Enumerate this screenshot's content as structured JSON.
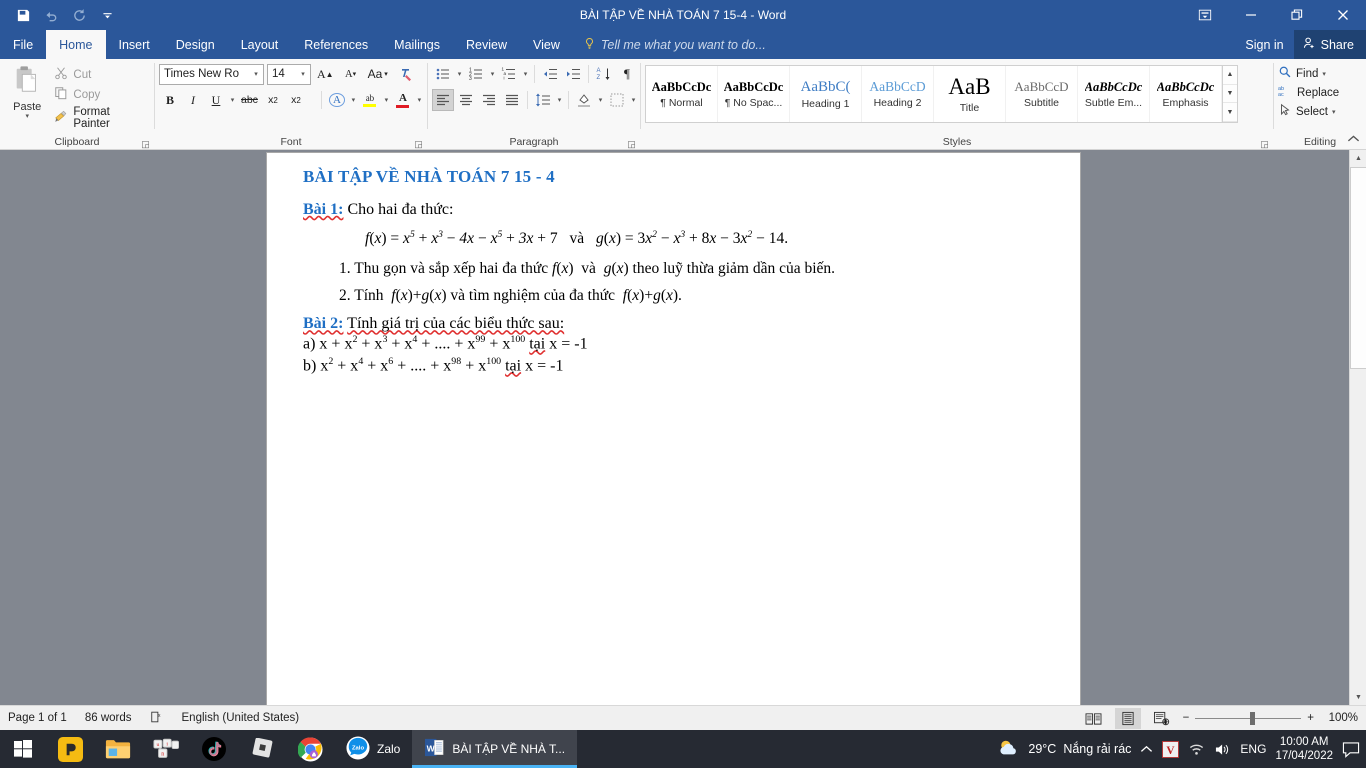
{
  "titlebar": {
    "title": "BÀI TẬP VỀ NHÀ TOÁN 7 15-4 - Word",
    "qat": [
      {
        "name": "save-icon",
        "label": "Save"
      },
      {
        "name": "undo-icon",
        "label": "Undo"
      },
      {
        "name": "redo-icon",
        "label": "Redo"
      },
      {
        "name": "customize-qat-icon",
        "label": "Customize Quick Access Toolbar"
      }
    ],
    "window_controls": [
      {
        "name": "ribbon-display-options-button",
        "label": "Ribbon Display Options"
      },
      {
        "name": "minimize-button",
        "label": "Minimize"
      },
      {
        "name": "restore-button",
        "label": "Restore Down"
      },
      {
        "name": "close-button",
        "label": "Close"
      }
    ]
  },
  "tabs": [
    {
      "label": "File",
      "active": false
    },
    {
      "label": "Home",
      "active": true
    },
    {
      "label": "Insert",
      "active": false
    },
    {
      "label": "Design",
      "active": false
    },
    {
      "label": "Layout",
      "active": false
    },
    {
      "label": "References",
      "active": false
    },
    {
      "label": "Mailings",
      "active": false
    },
    {
      "label": "Review",
      "active": false
    },
    {
      "label": "View",
      "active": false
    }
  ],
  "tell_me": "Tell me what you want to do...",
  "account": {
    "sign_in": "Sign in",
    "share": "Share"
  },
  "ribbon": {
    "clipboard": {
      "group_label": "Clipboard",
      "paste_label": "Paste",
      "cut_label": "Cut",
      "copy_label": "Copy",
      "format_painter_label": "Format Painter"
    },
    "font": {
      "group_label": "Font",
      "font_name": "Times New Ro",
      "font_size": "14",
      "buttons": [
        {
          "name": "grow-font-button",
          "label": "A"
        },
        {
          "name": "shrink-font-button",
          "label": "A"
        },
        {
          "name": "change-case-button",
          "label": "Aa"
        },
        {
          "name": "clear-formatting-button",
          "label": "Clear Formatting"
        },
        {
          "name": "bold-button",
          "label": "B"
        },
        {
          "name": "italic-button",
          "label": "I"
        },
        {
          "name": "underline-button",
          "label": "U"
        },
        {
          "name": "strikethrough-button",
          "label": "abc"
        },
        {
          "name": "subscript-button",
          "label": "x₂"
        },
        {
          "name": "superscript-button",
          "label": "x²"
        },
        {
          "name": "text-effects-button",
          "label": "A"
        },
        {
          "name": "text-highlight-color-button",
          "label": "ab"
        },
        {
          "name": "font-color-button",
          "label": "A"
        }
      ]
    },
    "paragraph": {
      "group_label": "Paragraph",
      "buttons": [
        {
          "name": "bullets-button",
          "label": "Bullets"
        },
        {
          "name": "numbering-button",
          "label": "Numbering"
        },
        {
          "name": "multilevel-list-button",
          "label": "Multilevel List"
        },
        {
          "name": "decrease-indent-button",
          "label": "Decrease Indent"
        },
        {
          "name": "increase-indent-button",
          "label": "Increase Indent"
        },
        {
          "name": "sort-button",
          "label": "Sort"
        },
        {
          "name": "show-formatting-marks-button",
          "label": "¶"
        },
        {
          "name": "align-left-button",
          "label": "Align Left"
        },
        {
          "name": "align-center-button",
          "label": "Center"
        },
        {
          "name": "align-right-button",
          "label": "Align Right"
        },
        {
          "name": "justify-button",
          "label": "Justify"
        },
        {
          "name": "line-spacing-button",
          "label": "Line and Paragraph Spacing"
        },
        {
          "name": "shading-button",
          "label": "Shading"
        },
        {
          "name": "borders-button",
          "label": "Borders"
        }
      ]
    },
    "styles": {
      "group_label": "Styles",
      "items": [
        {
          "preview": "AaBbCcDc",
          "name": "¶ Normal",
          "style": "normal"
        },
        {
          "preview": "AaBbCcDc",
          "name": "¶ No Spac...",
          "style": "nospacing"
        },
        {
          "preview": "AaBbC(",
          "name": "Heading 1",
          "style": "heading1"
        },
        {
          "preview": "AaBbCcD",
          "name": "Heading 2",
          "style": "heading2"
        },
        {
          "preview": "AaB",
          "name": "Title",
          "style": "title"
        },
        {
          "preview": "AaBbCcD",
          "name": "Subtitle",
          "style": "subtitle"
        },
        {
          "preview": "AaBbCcDc",
          "name": "Subtle Em...",
          "style": "subtleem"
        },
        {
          "preview": "AaBbCcDc",
          "name": "Emphasis",
          "style": "emphasis"
        }
      ]
    },
    "editing": {
      "group_label": "Editing",
      "find_label": "Find",
      "replace_label": "Replace",
      "select_label": "Select"
    }
  },
  "document": {
    "title": "BÀI TẬP VỀ NHÀ TOÁN 7 15 - 4",
    "bai1_label": "Bài 1:",
    "bai1_text": "Cho hai đa thức:",
    "formula_fx": "f(x) = x⁵ + x³ − 4x − x⁵ + 3x + 7",
    "formula_conj": "và",
    "formula_gx": "g(x) = 3x² − x³ + 8x − 3x² − 14.",
    "items": [
      "1. Thu gọn và sắp xếp hai đa thức f(x) và g(x) theo luỹ thừa giảm dần của biến.",
      "2. Tính f(x) + g(x) và tìm nghiệm của đa thức f(x) + g(x)."
    ],
    "bai2_label": "Bài 2:",
    "bai2_text": "Tính giá trị của các biểu thức sau:",
    "line_a": "a) x + x² + x³ + x⁴ + .... + x⁹⁹ + x¹⁰⁰ tại x = -1",
    "line_b": "b) x² + x⁴ + x⁶ + .... + x⁹⁸ + x¹⁰⁰ tại x = -1"
  },
  "statusbar": {
    "page": "Page 1 of 1",
    "words": "86 words",
    "proofing_icon": "proofing-errors-icon",
    "language": "English (United States)",
    "views": [
      {
        "name": "read-mode-button",
        "active": false
      },
      {
        "name": "print-layout-button",
        "active": true
      },
      {
        "name": "web-layout-button",
        "active": false
      }
    ],
    "zoom_out": "−",
    "zoom_in": "+",
    "zoom_level": "100%"
  },
  "taskbar": {
    "start_label": "Start",
    "pinned": [
      {
        "name": "taskbar-icon-pdf",
        "label": "PDF Reader"
      },
      {
        "name": "taskbar-icon-file-explorer",
        "label": "File Explorer"
      },
      {
        "name": "taskbar-icon-unikey",
        "label": "UniKey"
      },
      {
        "name": "taskbar-icon-tiktok",
        "label": "TikTok"
      },
      {
        "name": "taskbar-icon-roblox",
        "label": "Roblox"
      },
      {
        "name": "taskbar-icon-chrome",
        "label": "Google Chrome"
      }
    ],
    "apps": [
      {
        "name": "taskbar-app-zalo",
        "label": "Zalo",
        "active": false
      },
      {
        "name": "taskbar-app-word",
        "label": "BÀI TẬP VỀ NHÀ T...",
        "active": true
      }
    ],
    "tray": {
      "weather_temp": "29°C",
      "weather_desc": "Nắng rải rác",
      "overflow": "^",
      "unikey_badge": "V",
      "language": "ENG",
      "time": "10:00 AM",
      "date": "17/04/2022",
      "action_center": "action-center-icon"
    }
  },
  "colors": {
    "word_blue": "#2b579a",
    "share_blue": "#1f4272",
    "doc_heading": "#1f6fc4",
    "taskbar": "#262a33",
    "accent_underline": "#4ab3f4"
  }
}
